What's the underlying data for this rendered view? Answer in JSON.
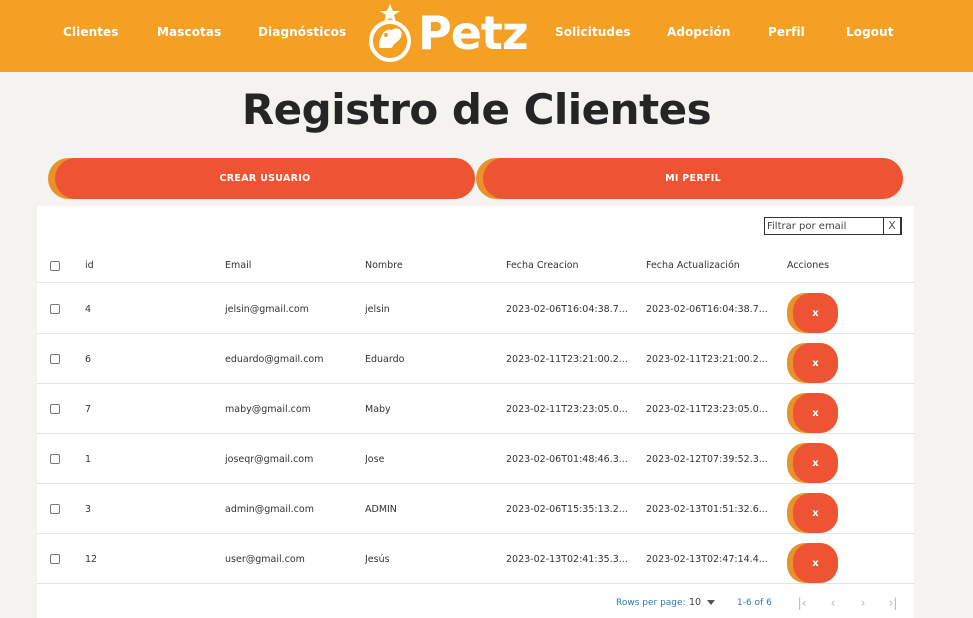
{
  "nav": {
    "clientes": "Clientes",
    "mascotas": "Mascotas",
    "diagnosticos": "Diagnósticos",
    "solicitudes": "Solicitudes",
    "adopcion": "Adopción",
    "perfil": "Perfil",
    "logout": "Logout"
  },
  "logo": {
    "text": "Petz",
    "icon": "pet-paw-logo-icon"
  },
  "page": {
    "title": "Registro de Clientes"
  },
  "actions": {
    "create_user": "CREAR USUARIO",
    "my_profile": "MI PERFIL"
  },
  "filter": {
    "placeholder": "Filtrar por email",
    "clear": "X"
  },
  "table": {
    "headers": {
      "id": "id",
      "email": "Email",
      "nombre": "Nombre",
      "fecha_creacion": "Fecha Creacion",
      "fecha_actualizacion": "Fecha Actualización",
      "acciones": "Acciones"
    },
    "delete_label": "x",
    "rows": [
      {
        "id": "4",
        "email": "jelsin@gmail.com",
        "nombre": "jelsin",
        "creacion": "2023-02-06T16:04:38.7...",
        "actualizacion": "2023-02-06T16:04:38.7..."
      },
      {
        "id": "6",
        "email": "eduardo@gmail.com",
        "nombre": "Eduardo",
        "creacion": "2023-02-11T23:21:00.2...",
        "actualizacion": "2023-02-11T23:21:00.2..."
      },
      {
        "id": "7",
        "email": "maby@gmail.com",
        "nombre": "Maby",
        "creacion": "2023-02-11T23:23:05.0...",
        "actualizacion": "2023-02-11T23:23:05.0..."
      },
      {
        "id": "1",
        "email": "joseqr@gmail.com",
        "nombre": "Jose",
        "creacion": "2023-02-06T01:48:46.3...",
        "actualizacion": "2023-02-12T07:39:52.3..."
      },
      {
        "id": "3",
        "email": "admin@gmail.com",
        "nombre": "ADMIN",
        "creacion": "2023-02-06T15:35:13.2...",
        "actualizacion": "2023-02-13T01:51:32.6..."
      },
      {
        "id": "12",
        "email": "user@gmail.com",
        "nombre": "Jesús",
        "creacion": "2023-02-13T02:41:35.3...",
        "actualizacion": "2023-02-13T02:47:14.4..."
      }
    ]
  },
  "pagination": {
    "rows_per_page_label": "Rows per page:",
    "rows_per_page_value": "10",
    "range": "1-6 of 6",
    "first": "|‹",
    "prev": "‹",
    "next": "›",
    "last": "›|"
  },
  "colors": {
    "navbar": "#f3a023",
    "button": "#ee5433",
    "button_shadow": "#e7922a",
    "background": "#f4f3ef",
    "pager_text": "#2d7aa8"
  }
}
